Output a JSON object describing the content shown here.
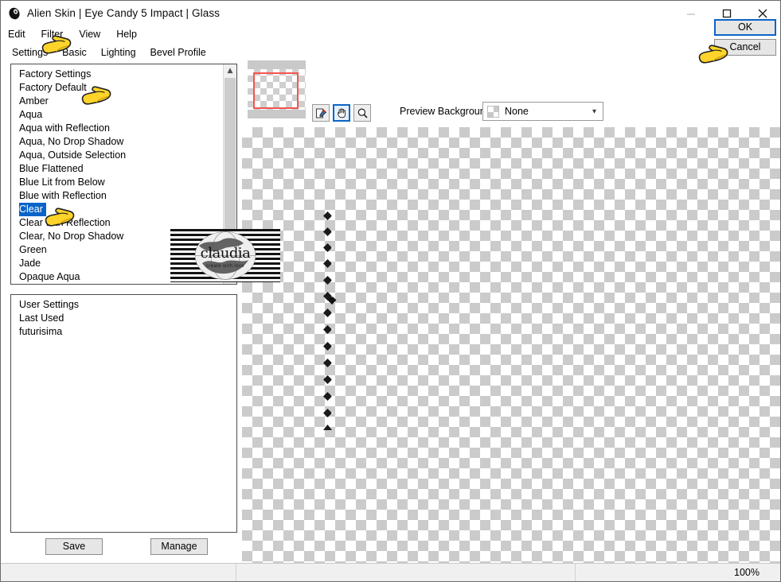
{
  "window": {
    "title": "Alien Skin | Eye Candy 5 Impact | Glass",
    "icon": "alienskin-logo-icon",
    "controls": {
      "minimize": "minimize-icon",
      "maximize": "maximize-icon",
      "close": "close-icon"
    }
  },
  "menubar": {
    "items": [
      {
        "label": "Edit"
      },
      {
        "label": "Filter"
      },
      {
        "label": "View"
      },
      {
        "label": "Help"
      }
    ]
  },
  "tabs": [
    {
      "label": "Settings",
      "active": true
    },
    {
      "label": "Basic",
      "active": false
    },
    {
      "label": "Lighting",
      "active": false
    },
    {
      "label": "Bevel Profile",
      "active": false
    }
  ],
  "factory_list": {
    "header": "Factory Settings",
    "items": [
      {
        "label": "Factory Default",
        "selected": false
      },
      {
        "label": "Amber",
        "selected": false
      },
      {
        "label": "Aqua",
        "selected": false
      },
      {
        "label": "Aqua with Reflection",
        "selected": false
      },
      {
        "label": "Aqua, No Drop Shadow",
        "selected": false
      },
      {
        "label": "Aqua, Outside Selection",
        "selected": false
      },
      {
        "label": "Blue Flattened",
        "selected": false
      },
      {
        "label": "Blue Lit from Below",
        "selected": false
      },
      {
        "label": "Blue with Reflection",
        "selected": false
      },
      {
        "label": "Clear",
        "selected": true
      },
      {
        "label": "Clear with Reflection",
        "selected": false
      },
      {
        "label": "Clear, No Drop Shadow",
        "selected": false
      },
      {
        "label": "Green",
        "selected": false
      },
      {
        "label": "Jade",
        "selected": false
      },
      {
        "label": "Opaque Aqua",
        "selected": false
      }
    ],
    "scrollbar": {
      "up": "scroll-up-arrow-icon",
      "down": "scroll-down-arrow-icon"
    }
  },
  "user_list": {
    "header": "User Settings",
    "items": [
      {
        "label": "Last Used"
      },
      {
        "label": "futurisima"
      }
    ]
  },
  "left_buttons": {
    "save": "Save",
    "manage": "Manage"
  },
  "preview": {
    "toolbar": [
      {
        "name": "color-picker-tool-icon",
        "active": false
      },
      {
        "name": "hand-pan-tool-icon",
        "active": true
      },
      {
        "name": "zoom-tool-icon",
        "active": false
      }
    ],
    "background_label": "Preview Background:",
    "background_value": "None",
    "caret": "chevron-down-icon",
    "navigator_frame_color": "#f4554f"
  },
  "action_buttons": {
    "ok": "OK",
    "cancel": "Cancel"
  },
  "statusbar": {
    "zoom": "100%"
  },
  "watermark": {
    "text": "claudia",
    "subtext": "create with love"
  },
  "cursors": [
    {
      "name": "pointing-hand-cursor",
      "target": "filter-menu"
    },
    {
      "name": "pointing-hand-cursor",
      "target": "factory-default-item"
    },
    {
      "name": "pointing-hand-cursor",
      "target": "clear-item"
    },
    {
      "name": "pointing-hand-cursor",
      "target": "ok-button"
    }
  ],
  "colors": {
    "accent": "#0a64c8",
    "panel": "#f0f0f0",
    "button": "#e6e6e6",
    "selection": "#0a64c8"
  }
}
